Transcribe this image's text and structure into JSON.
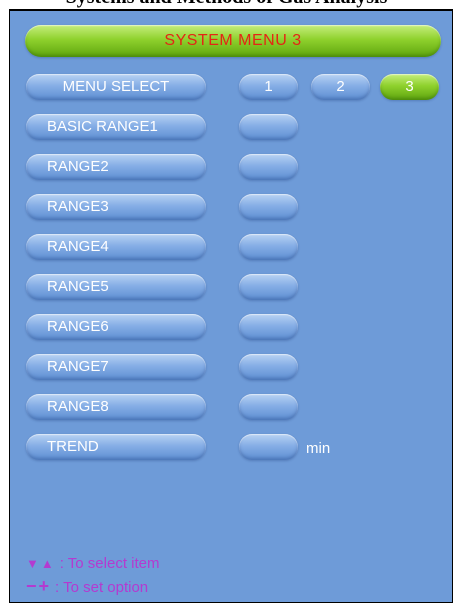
{
  "header": {
    "cropped_text": "Systems and Methods of Gas Analysis"
  },
  "title": "SYSTEM MENU 3",
  "menu_select": {
    "label": "MENU SELECT",
    "options": [
      "1",
      "2",
      "3"
    ],
    "selected": "3"
  },
  "items": [
    {
      "label": "BASIC RANGE1",
      "value": ""
    },
    {
      "label": "RANGE2",
      "value": ""
    },
    {
      "label": "RANGE3",
      "value": ""
    },
    {
      "label": "RANGE4",
      "value": ""
    },
    {
      "label": "RANGE5",
      "value": ""
    },
    {
      "label": "RANGE6",
      "value": ""
    },
    {
      "label": "RANGE7",
      "value": ""
    },
    {
      "label": "RANGE8",
      "value": ""
    },
    {
      "label": "TREND",
      "value": "",
      "unit": "min"
    }
  ],
  "help": [
    {
      "symbols": "▼▲",
      "text": ": To select item"
    },
    {
      "symbols": "−+",
      "text": ": To set option"
    }
  ],
  "colors": {
    "panel_background": "#6e9bd8",
    "button_blue": "#86aee6",
    "button_green": "#8fd12d",
    "title_text": "#e42515",
    "help_text": "#b43ad0"
  }
}
